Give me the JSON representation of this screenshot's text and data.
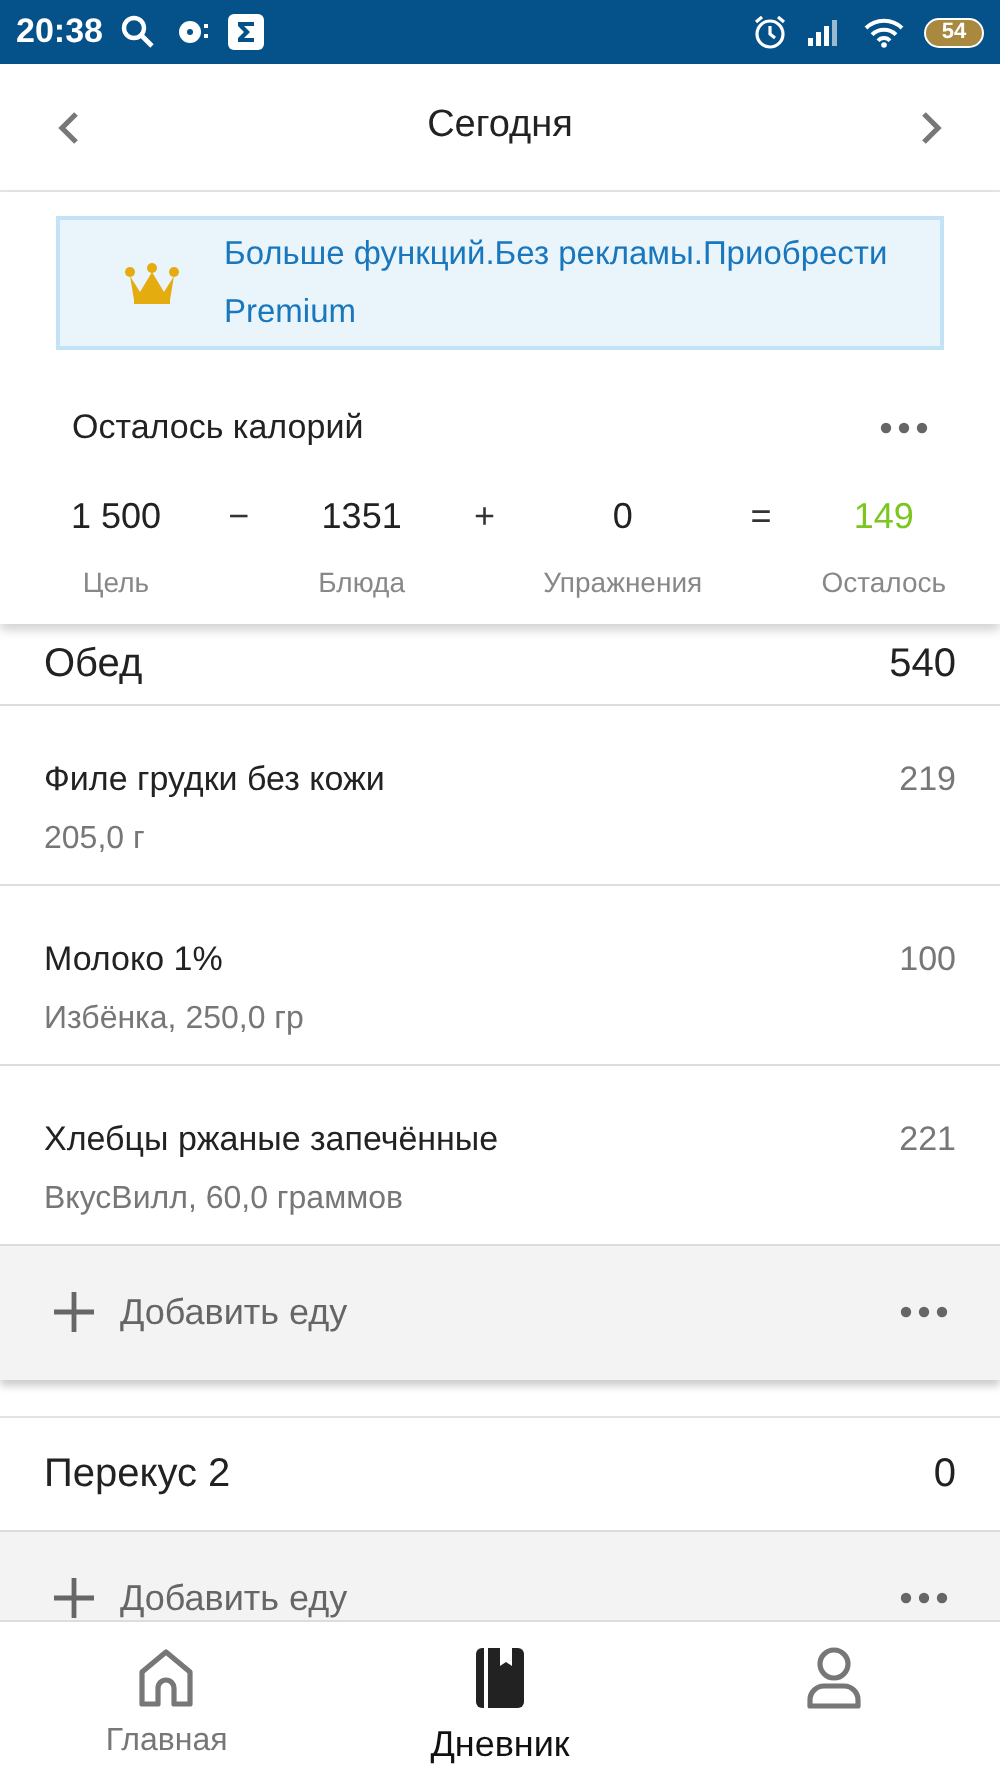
{
  "status_bar": {
    "time": "20:38",
    "battery": "54"
  },
  "header": {
    "title": "Сегодня"
  },
  "banner": {
    "text": "Больше функций.Без рекламы.Приобрести Premium"
  },
  "summary": {
    "title": "Осталось калорий",
    "items": [
      {
        "kind": "value",
        "value": "1 500",
        "label": "Цель"
      },
      {
        "kind": "operator",
        "value": "−"
      },
      {
        "kind": "value",
        "value": "1351",
        "label": "Блюда"
      },
      {
        "kind": "operator",
        "value": "+"
      },
      {
        "kind": "value",
        "value": "0",
        "label": "Упражнения"
      },
      {
        "kind": "operator",
        "value": "="
      },
      {
        "kind": "result",
        "value": "149",
        "label": "Осталось"
      }
    ]
  },
  "meals": [
    {
      "name": "Обед",
      "calories": "540",
      "foods": [
        {
          "name": "Филе грудки без кожи",
          "detail": "205,0 г",
          "calories": "219"
        },
        {
          "name": "Молоко 1%",
          "detail": "Избёнка, 250,0 гр",
          "calories": "100"
        },
        {
          "name": "Хлебцы ржаные запечённые",
          "detail": "ВкусВилл, 60,0 граммов",
          "calories": "221"
        }
      ],
      "add_label": "Добавить еду"
    },
    {
      "name": "Перекус 2",
      "calories": "0",
      "add_label": "Добавить еду"
    }
  ],
  "nav": [
    {
      "label": "Главная",
      "selected": false
    },
    {
      "label": "Дневник",
      "selected": true
    },
    {
      "selected": false
    }
  ]
}
